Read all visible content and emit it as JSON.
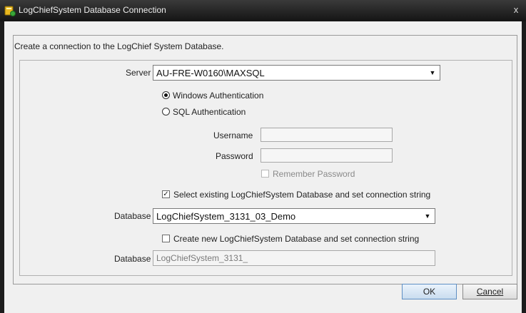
{
  "window": {
    "title": "LogChiefSystem Database Connection",
    "close_glyph": "x"
  },
  "intro_text": "Create a connection to the LogChief System Database.",
  "server": {
    "label": "Server",
    "value": "AU-FRE-W0160\\MAXSQL"
  },
  "auth": {
    "windows_label": "Windows Authentication",
    "sql_label": "SQL Authentication",
    "selected": "windows"
  },
  "credentials": {
    "username_label": "Username",
    "username_value": "",
    "password_label": "Password",
    "password_value": "",
    "remember_label": "Remember Password",
    "remember_checked": false
  },
  "select_existing": {
    "label": "Select existing LogChiefSystem Database and set connection string",
    "checked": true,
    "check_glyph": "✓",
    "db_label": "Database",
    "db_value": "LogChiefSystem_3131_03_Demo"
  },
  "create_new": {
    "label": "Create new LogChiefSystem Database and set connection string",
    "checked": false,
    "db_label": "Database",
    "db_value": "LogChiefSystem_3131_"
  },
  "buttons": {
    "ok": "OK",
    "cancel": "Cancel"
  },
  "icons": {
    "app": "database-connection-icon",
    "dropdown": "chevron-down-icon",
    "close": "close-icon"
  },
  "colors": {
    "titlebar": "#1c1c1c",
    "dialog_bg": "#f0f0f0",
    "ok_border": "#5f8fc3"
  }
}
